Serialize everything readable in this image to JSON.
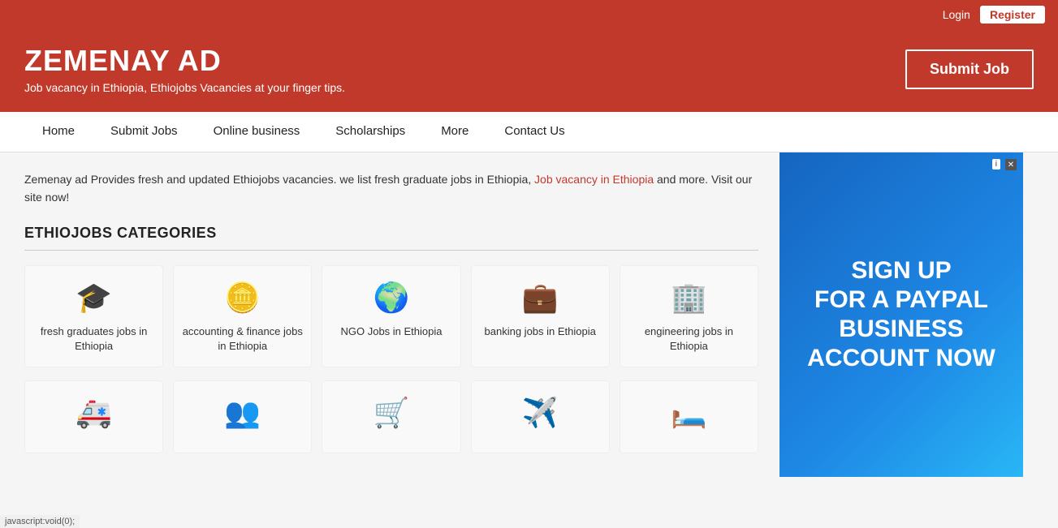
{
  "topbar": {
    "login_label": "Login",
    "register_label": "Register"
  },
  "header": {
    "logo_title": "ZEMENAY AD",
    "logo_subtitle": "Job vacancy in Ethiopia, Ethiojobs Vacancies at your finger tips.",
    "submit_job_label": "Submit Job"
  },
  "nav": {
    "items": [
      {
        "label": "Home",
        "id": "home"
      },
      {
        "label": "Submit Jobs",
        "id": "submit-jobs"
      },
      {
        "label": "Online business",
        "id": "online-business"
      },
      {
        "label": "Scholarships",
        "id": "scholarships"
      },
      {
        "label": "More",
        "id": "more"
      },
      {
        "label": "Contact Us",
        "id": "contact-us"
      }
    ]
  },
  "intro": {
    "text1": "Zemenay ad Provides fresh and updated Ethiojobs vacancies. we list fresh graduate jobs in Ethiopia, ",
    "link_text": "Job vacancy in Ethiopia",
    "text2": " and more. Visit our site now!"
  },
  "categories_section": {
    "heading": "ETHIOJOBS CATEGORIES"
  },
  "categories_row1": [
    {
      "id": "fresh-graduates",
      "icon": "🎓",
      "label": "fresh graduates jobs in Ethiopia"
    },
    {
      "id": "accounting-finance",
      "icon": "💰",
      "label": "accounting & finance jobs in Ethiopia"
    },
    {
      "id": "ngo-jobs",
      "icon": "🌍",
      "label": "NGO Jobs in Ethiopia"
    },
    {
      "id": "banking-jobs",
      "icon": "💼",
      "label": "banking jobs in Ethiopia"
    },
    {
      "id": "engineering-jobs",
      "icon": "🏢",
      "label": "engineering jobs in Ethiopia"
    }
  ],
  "categories_row2": [
    {
      "id": "health-jobs",
      "icon": "🚑",
      "label": ""
    },
    {
      "id": "social-jobs",
      "icon": "👥",
      "label": ""
    },
    {
      "id": "retail-jobs",
      "icon": "🛒",
      "label": ""
    },
    {
      "id": "aviation-jobs",
      "icon": "✈️",
      "label": ""
    },
    {
      "id": "hospitality-jobs",
      "icon": "🛏️",
      "label": ""
    }
  ],
  "sidebar_ad": {
    "text": "SIGN UP FOR A PAYPAL BUSINESS ACCOUNT NOW",
    "badge": "i",
    "close": "✕"
  },
  "statusbar": {
    "text": "javascript:void(0);"
  }
}
